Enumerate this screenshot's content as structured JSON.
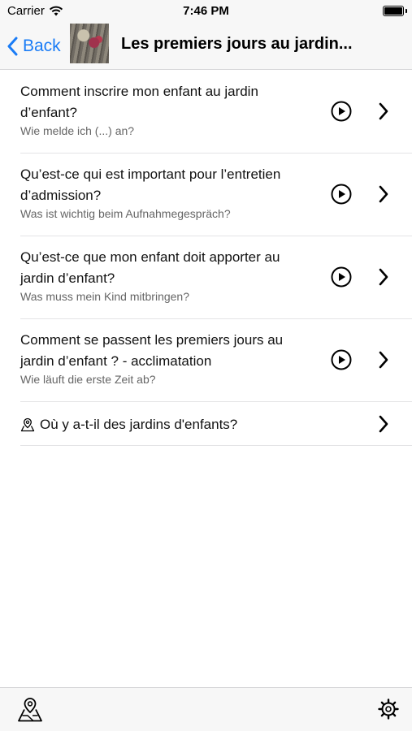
{
  "status_bar": {
    "carrier": "Carrier",
    "time": "7:46 PM",
    "battery_level": 1.0
  },
  "nav": {
    "back_label": "Back",
    "title": "Les premiers jours au jardin..."
  },
  "list": {
    "items": [
      {
        "title": "Comment inscrire mon enfant au jardin d’enfant?",
        "subtitle": "Wie melde ich (...) an?"
      },
      {
        "title": "Qu’est-ce qui est important pour l’entretien d’admission?",
        "subtitle": "Was ist wichtig beim Aufnahmegespräch?"
      },
      {
        "title": "Qu’est-ce que mon enfant doit apporter au jardin d’enfant?",
        "subtitle": "Was muss mein Kind mitbringen?"
      },
      {
        "title": "Comment se passent les premiers jours au jardin d’enfant ? - acclimatation",
        "subtitle": "Wie läuft die erste Zeit ab?"
      }
    ],
    "location_item": {
      "title": "Où y a-t-il des jardins d'enfants?"
    }
  },
  "colors": {
    "accent": "#1a7cf6",
    "bar_background": "#f7f7f7",
    "separator": "#e4e4e6"
  },
  "icons": [
    "wifi-icon",
    "battery-icon",
    "chevron-left-icon",
    "play-icon",
    "chevron-right-icon",
    "map-pin-icon",
    "map-icon",
    "gear-icon"
  ]
}
